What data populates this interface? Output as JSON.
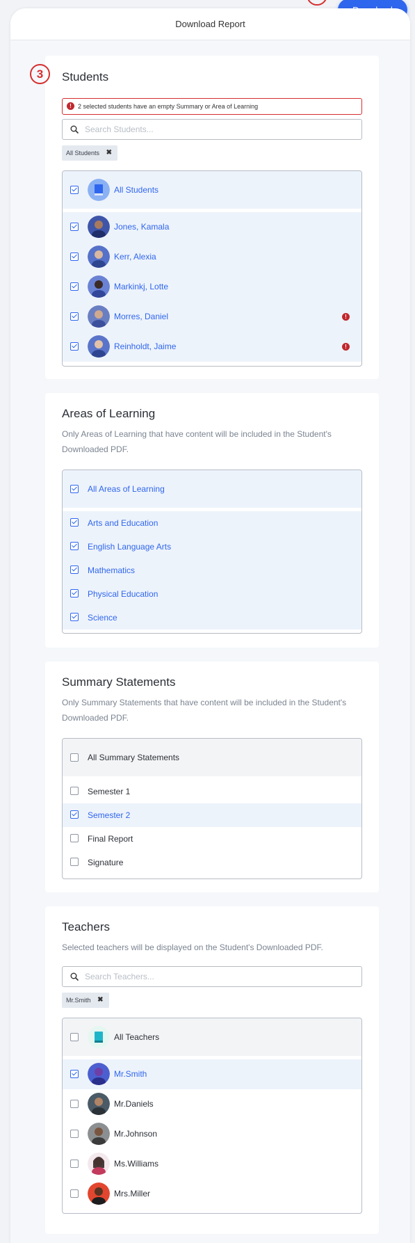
{
  "header": {
    "title": "Download Report",
    "download_label": "Download"
  },
  "students": {
    "step": "3",
    "title": "Students",
    "error_text": "2 selected students have an empty Summary or Area of Learning",
    "search_placeholder": "Search Students...",
    "chip": "All Students",
    "all_label": "All Students",
    "items": [
      {
        "name": "Jones, Kamala",
        "checked": true,
        "warning": false
      },
      {
        "name": "Kerr, Alexia",
        "checked": true,
        "warning": false
      },
      {
        "name": "Markinkj, Lotte",
        "checked": true,
        "warning": false
      },
      {
        "name": "Morres, Daniel",
        "checked": true,
        "warning": true
      },
      {
        "name": "Reinholdt, Jaime",
        "checked": true,
        "warning": true
      }
    ]
  },
  "areas": {
    "title": "Areas of Learning",
    "description": "Only Areas of Learning that have content will be included in the Student's Downloaded PDF.",
    "all_label": "All Areas of Learning",
    "items": [
      "Arts and Education",
      "English Language Arts",
      "Mathematics",
      "Physical Education",
      "Science"
    ]
  },
  "summary": {
    "title": "Summary Statements",
    "description": "Only Summary Statements that have content will be included in the Student's Downloaded PDF.",
    "all_label": "All Summary Statements",
    "items": [
      {
        "label": "Semester 1",
        "checked": false
      },
      {
        "label": "Semester 2",
        "checked": true
      },
      {
        "label": "Final Report",
        "checked": false
      },
      {
        "label": "Signature",
        "checked": false
      }
    ]
  },
  "teachers": {
    "title": "Teachers",
    "description": "Selected teachers will be displayed on the Student's Downloaded PDF.",
    "search_placeholder": "Search Teachers...",
    "chip": "Mr.Smith",
    "all_label": "All Teachers",
    "items": [
      {
        "name": "Mr.Smith",
        "checked": true
      },
      {
        "name": "Mr.Daniels",
        "checked": false
      },
      {
        "name": "Mr.Johnson",
        "checked": false
      },
      {
        "name": "Ms.Williams",
        "checked": false
      },
      {
        "name": "Mrs.Miller",
        "checked": false
      }
    ]
  },
  "colors": {
    "accent": "#2f66ee",
    "error": "#d62e2e",
    "selected_row": "#edf3fb"
  },
  "icons": [
    "search-icon",
    "close-icon",
    "alert-icon",
    "check-icon",
    "book-icon"
  ]
}
